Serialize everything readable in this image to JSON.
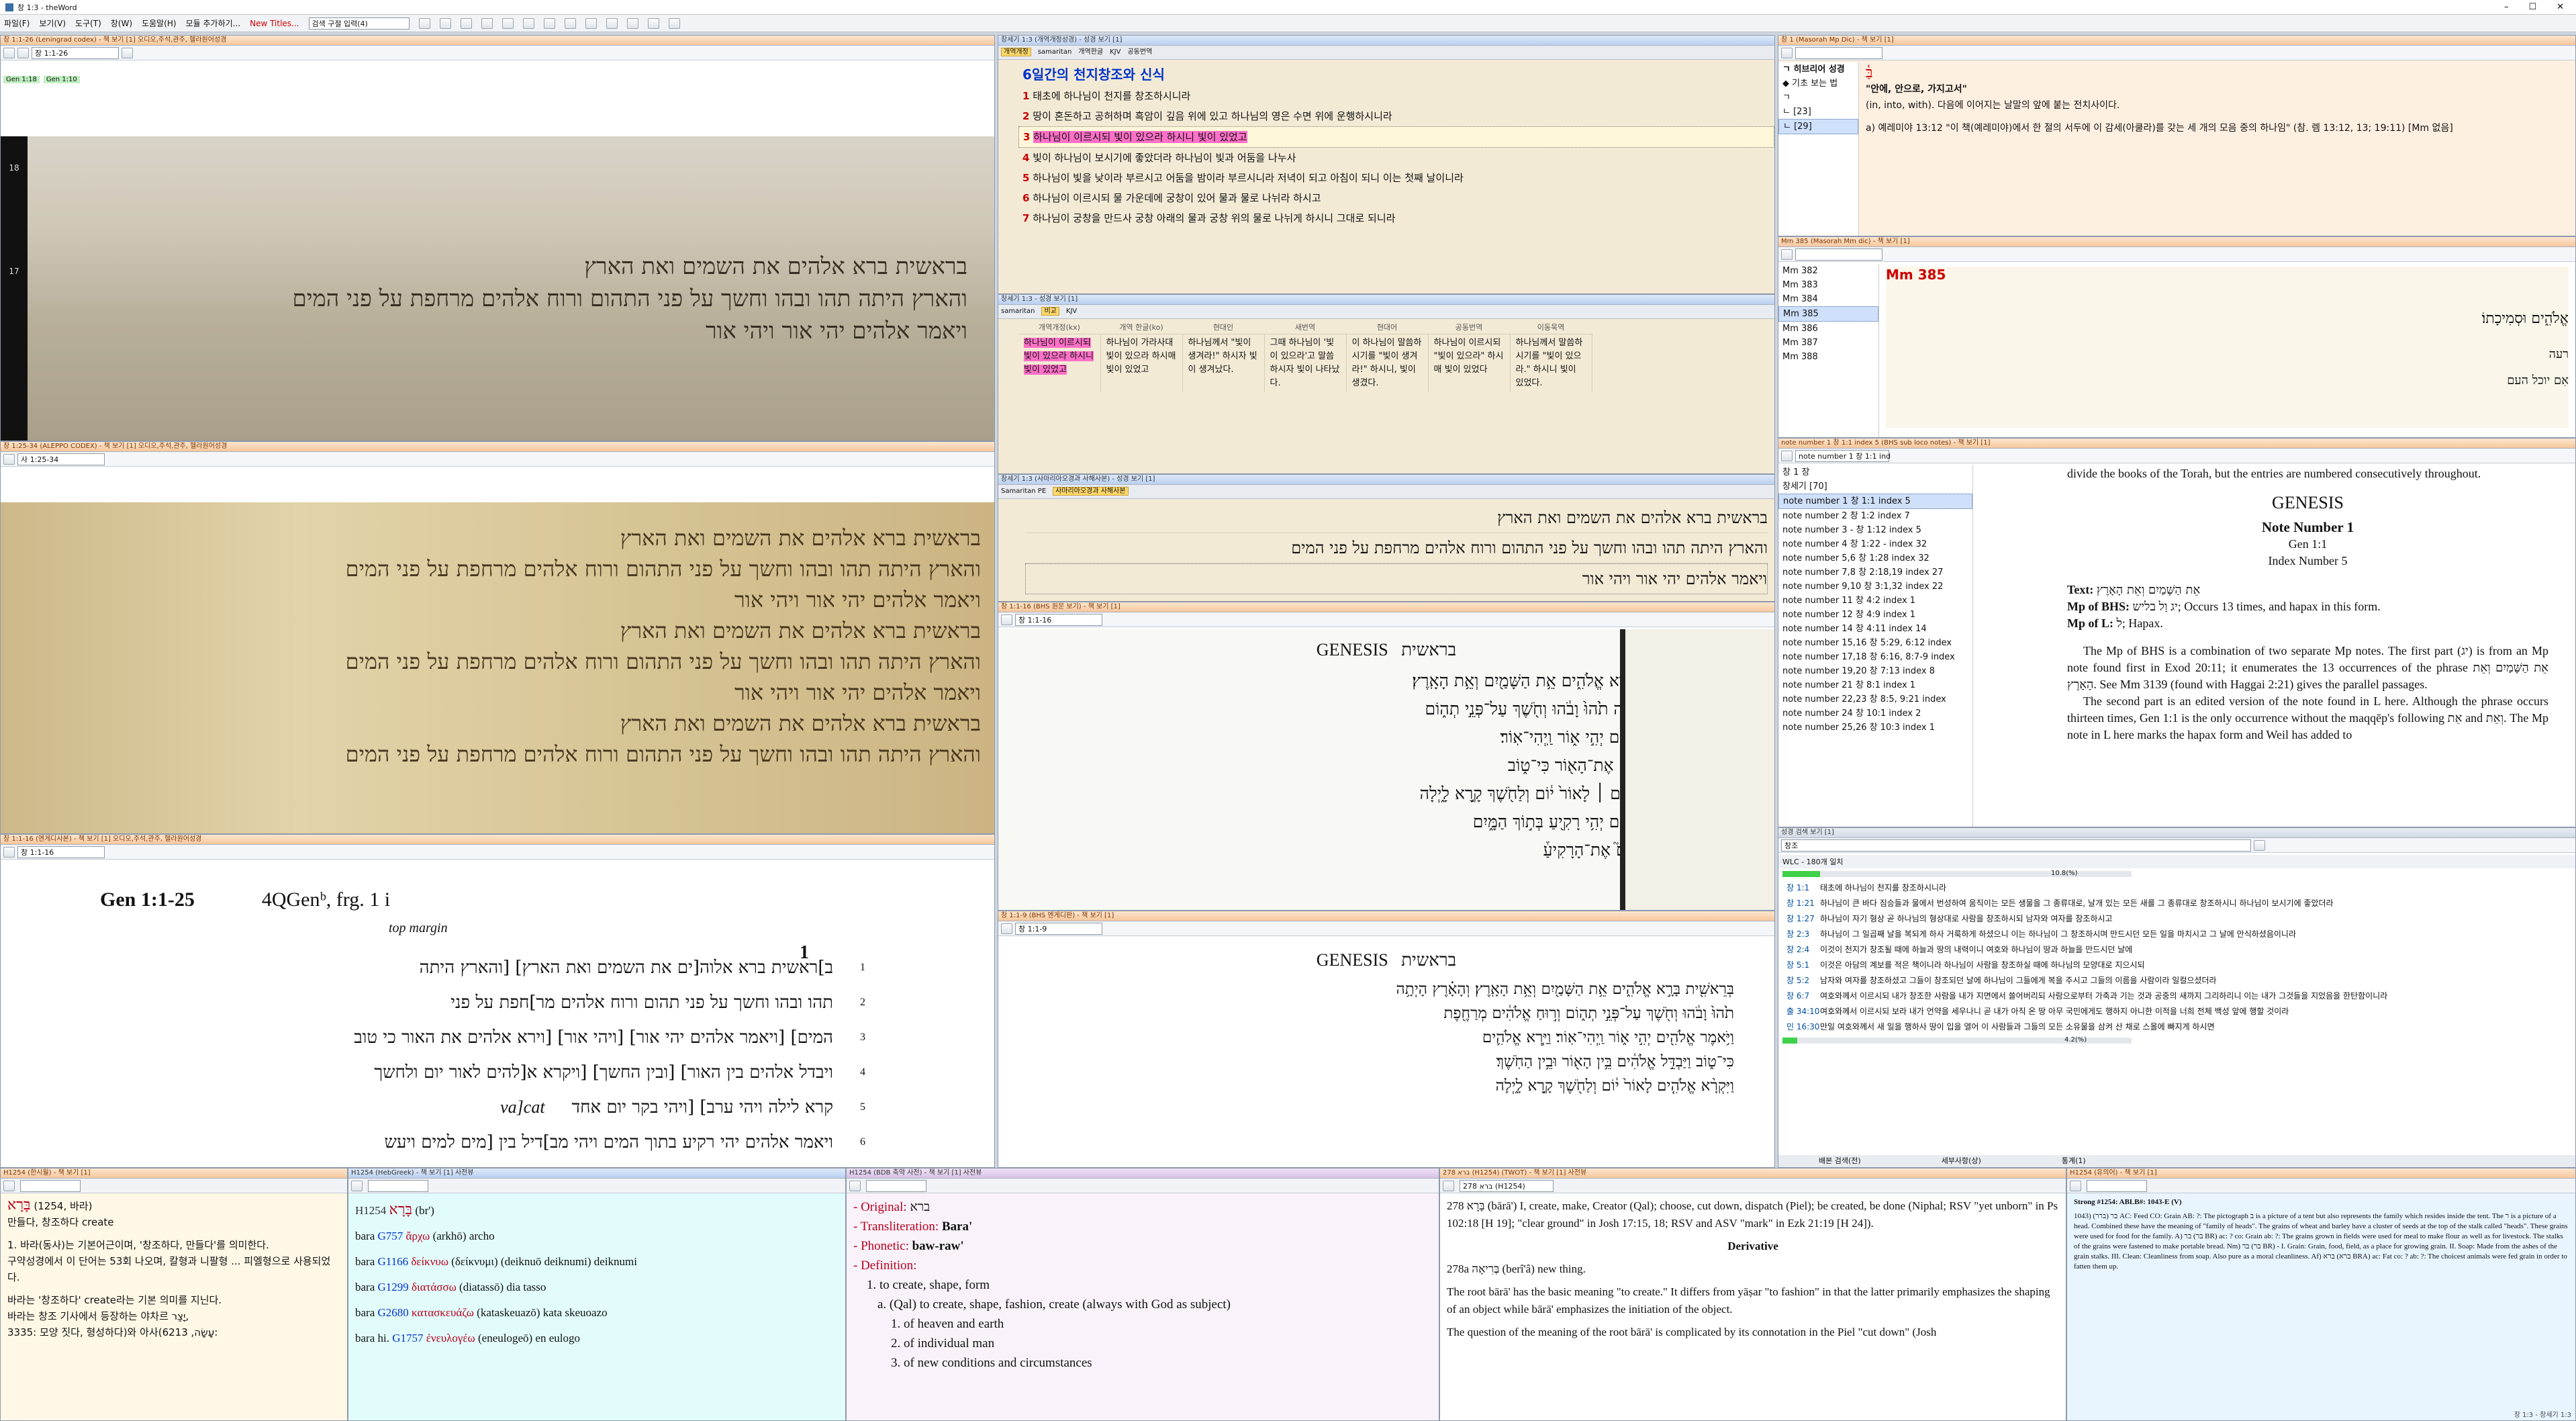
{
  "titlebar": {
    "title": "창 1:3 - theWord"
  },
  "menubar": [
    "파일(F)",
    "보기(V)",
    "도구(T)",
    "창(W)",
    "도움말(H)",
    "모듈 추가하기...",
    "New Titles...",
    "검색 구절 입력(4)"
  ],
  "panels": {
    "leningrad": {
      "title": "창 1:1-26 (Leningrad codex) - 책 보기 [1] 오디오,주석,관주, 헬라원어성경",
      "ref": "창 1:1-26",
      "badges": [
        "Gen 1:18",
        "Gen 1:10"
      ],
      "side": [
        "18",
        "17"
      ]
    },
    "aleppo": {
      "title": "창 1:25-34 (ALEPPO CODEX) - 책 보기 [1] 오디오,주석,관주, 헬라원어성경",
      "ref": "사 1:25-34"
    },
    "dss": {
      "title": "창 1:1-16 (엔게디사본) - 책 보기 [1] 오디오,주석,관주, 헬라원어성경",
      "ref": "창 1:1-16",
      "ref_title": "Gen 1:1-25",
      "frag": "4QGenᵇ, frg. 1 i",
      "margin": "top margin",
      "big_num": "1",
      "lines": [
        {
          "n": "1",
          "t": "ב]ראשית ברא אלוה[ים את השמים ואת הארץ] [והארץ היתה"
        },
        {
          "n": "2",
          "t": "תהו ובהו וחשך על פני תהום ורוח אלהים מר]חפת על פני"
        },
        {
          "n": "3",
          "t": "המים] [ויאמר אלהים יהי אור] [ויהי אור] [וירא אלהים את האור כי טוב"
        },
        {
          "n": "4",
          "t": "ויבדל אלהים בין האור] [ובין החשך] [ויקרא א[להים לאור יום ולחשך"
        },
        {
          "n": "5",
          "t": "קרא לילה ויהי ערב] [ויהי בקר יום אחד"
        },
        {
          "n": "6",
          "t": "ויאמר אלהים יהי רקיע בתוך המים ויהי מב]דיל בין [מים למים ויעש"
        }
      ],
      "vacat": "va]cat"
    },
    "korean": {
      "title": "창세기 1:3 (개역개정성경) - 성경 보기 [1]",
      "heading": "6일간의 천지창조와 신식",
      "verses": [
        {
          "n": "1",
          "t": "태초에 하나님이 천지를 창조하시니라"
        },
        {
          "n": "2",
          "t": "땅이 혼돈하고 공허하며 흑암이 깊음 위에 있고 하나님의 영은 수면 위에 운행하시니라"
        },
        {
          "n": "3",
          "t": "하나님이 이르시되 빛이 있으라 하시니 빛이 있었고"
        },
        {
          "n": "4",
          "t": "빛이 하나님이 보시기에 좋았더라 하나님이 빛과 어둠을 나누사"
        },
        {
          "n": "5",
          "t": "하나님이 빛을 낮이라 부르시고 어둠을 밤이라 부르시니라 저녁이 되고 아침이 되니 이는 첫째 날이니라"
        },
        {
          "n": "6",
          "t": "하나님이 이르시되 물 가운데에 궁창이 있어 물과 물로 나뉘라 하시고"
        },
        {
          "n": "7",
          "t": "하나님이 궁창을 만드사 궁창 아래의 물과 궁창 위의 물로 나뉘게 하시니 그대로 되니라"
        }
      ]
    },
    "compare": {
      "title": "창세기 1:3 - 성경 보기 [1]",
      "cols": [
        "개역개정(kx)",
        "개역 한글(ko)",
        "현대인",
        "새번역",
        "현대어",
        "공동번역",
        "이동욱역"
      ],
      "cells": [
        "하나님이 이르시되 빛이 있으라 하시니 빛이 있었고",
        "하나님이 가라사대 빛이 있으라 하시매 빛이 있었고",
        "하나님께서 \"빛이 생겨라!\" 하시자 빛이 생겨났다.",
        "그때 하나님이 '빛이 있으라'고 말씀하시자 빛이 나타났다.",
        "이 하나님이 말씀하시기를 \"빛이 생겨라!\" 하시니, 빛이 생겼다.",
        "하나님이 이르시되 \"빛이 있으라\" 하시매 빛이 있었다",
        "하나님께서 말씀하시기를 \"빛이 있으라.\" 하시니 빛이 있었다."
      ]
    },
    "bhs": {
      "title": "창세기 1:3 (사마리아오경과 사해사본) - 성경 보기 [1]",
      "lines": [
        "בראשית ברא אלהים את השמים ואת הארץ",
        "והארץ היתה תהו ובהו וחשך על פני התהום ורוח אלהים מרחפת על פני המים",
        "ויאמר אלהים יהי אור ויהי אור"
      ]
    },
    "bhs_print": {
      "title": "창 1:1-16 (BHS 원문 보기) - 책 보기 [1]",
      "ref": "창 1:1-16",
      "head_en": "GENESIS",
      "head_he": "בראשית",
      "lines": [
        "בְּרֵאשִׁ֖ית בָּרָ֣א אֱלֹהִ֑ים אֵ֥ת הַשָּׁמַ֖יִם וְאֵ֥ת הָאָֽרֶץ׃",
        "וְהָאָ֗רֶץ הָיְתָ֥ה תֹ֙הוּ֙ וָבֹ֔הוּ וְחֹ֖שֶׁךְ עַל־פְּנֵ֣י תְה֑וֹם",
        "וַיֹּ֥אמֶר אֱלֹהִ֖ים יְהִ֣י א֑וֹר וַֽיְהִי־אֽוֹר׃",
        "וַיַּ֧רְא אֱלֹהִ֛ים אֶת־הָא֖וֹר כִּי־ט֑וֹב",
        "וַיִּקְרָ֨א אֱלֹהִ֤ים ׀ לָאוֹר֙ י֔וֹם וְלַחֹ֖שֶׁךְ קָ֣רָא לָ֑יְלָה",
        "וַיֹּ֣אמֶר אֱלֹהִ֔ים יְהִ֥י רָקִ֖יעַ בְּת֣וֹךְ הַמָּ֑יִם",
        "וַיַּ֣עַשׂ אֱלֹהִים֮ אֶת־הָרָקִיעַ֒"
      ]
    },
    "bhs_print2": {
      "title": "창 1:1-9 (BHS 엔게디판) - 책 보기 [1]",
      "ref": "창 1:1-9",
      "head_en": "GENESIS",
      "head_he": "בראשית",
      "lines": [
        "בְּרֵאשִׁ֖ית בָּרָ֣א אֱלֹהִ֑ים אֵ֥ת הַשָּׁמַ֖יִם וְאֵ֥ת הָאָֽרֶץ׃ וְהָאָ֗רֶץ הָיְתָ֥ה",
        "תֹ֙הוּ֙ וָבֹ֔הוּ וְחֹ֖שֶׁךְ עַל־פְּנֵ֣י תְה֑וֹם וְר֣וּחַ אֱלֹהִ֔ים מְרַחֶ֖פֶת",
        "וַיֹּ֥אמֶר אֱלֹהִ֖ים יְהִ֣י א֑וֹר וַֽיְהִי־אֽוֹר׃ וַיַּ֧רְא אֱלֹהִ֛ים",
        "כִּי־ט֑וֹב וַיַּבְדֵּ֣ל אֱלֹהִ֔ים בֵּ֥ין הָא֖וֹר וּבֵ֥ין הַחֹֽשֶׁךְ׃",
        "וַיִּקְרָ֨א אֱלֹהִ֤ים לָאוֹר֙ י֔וֹם וְלַחֹ֖שֶׁךְ קָ֣רָא לָ֑יְלָה"
      ]
    },
    "masorah": {
      "title": "창 1 (Masorah Mp Dic) - 책 보기 [1]",
      "heading": "ㄱ 히브리어 성경",
      "bullet": "◆ 기초 보는 법",
      "items": [
        "ㄱ",
        "ㄴ [23]",
        "ㄴ [29]"
      ],
      "word": "בַּ֫",
      "def": "\"안에, 안으로, 가지고서\"",
      "sub": "(in, into, with). 다음에 이어지는 날말의 앞에 붙는 전치사이다.",
      "ex": "a) 예레미야 13:12 \"이 책(예레미야)에서 한 절의 서두에 이 감세(아쿨라)를 갖는 세 개의 모음 중의 하나임\" (참. 렘 13:12, 13; 19:11) [Mm 없음]"
    },
    "mm": {
      "title": "Mm 385 (Masorah Mm dic) - 책 보기 [1]",
      "items": [
        "Mm 382",
        "Mm 383",
        "Mm 384",
        "Mm 385",
        "Mm 386",
        "Mm 387",
        "Mm 388"
      ],
      "head": "Mm 385",
      "l1": "אֱלֹהִ֑ים וּסְמִיכָתוֹ׃",
      "l2": "רעה",
      "l3": "אִם יוכל העם"
    },
    "notes": {
      "title": "note number 1 창 1:1 index 5 (BHS sub loco notes) - 책 보기 [1]",
      "sel": "note number 1 창 1:1 ind",
      "items": [
        "창 1 장",
        "창세기 [70]",
        "note number 1 창 1:1 index 5",
        "note number 2 창 1:2 index 7",
        "note number 3 - 창 1:12 index 5",
        "note number 4 창 1:22 - index 32",
        "note number 5,6 창 1:28 index 32",
        "note number 7,8 창 2:18,19 index 27",
        "note number 9,10 창 3:1,32 index 22",
        "note number 11 창 4:2 index 1",
        "note number 12 창 4:9 index 1",
        "note number 14 창 4:11 index 14",
        "note number 15,16 창 5:29, 6:12 index",
        "note number 17,18 창 6:16, 8:7-9 index",
        "note number 19,20 창 7:13 index 8",
        "note number 21 창 8:1 index 1",
        "note number 22,23 창 8:5, 9:21 index",
        "note number 24 창 10:1 index 2",
        "note number 25,26 창 10:3 index 1"
      ],
      "top": "divide the books of the Torah, but the entries are numbered consecutively throughout.",
      "h1": "GENESIS",
      "h2": "Note Number 1",
      "h3": "Gen 1:1",
      "h4": "Index Number 5",
      "text_k": "Text:",
      "text_v": "אֵת הַשָּׁמַיִם וְאֵת הָאָרֶץ",
      "mpb_k": "Mp of BHS:",
      "mpb_v": "יג וַל בליש; Occurs 13 times, and hapax in this form.",
      "mpl_k": "Mp of L:",
      "mpl_v": "ל; Hapax.",
      "p1": "The Mp of BHS is a combination of two separate Mp notes. The first part (יג) is from an Mp note found first in Exod 20:11; it enumerates the 13 occurrences of the phrase אֵת הַשָּׁמַיִם וְאֵת הָאָרֶץ. See Mm 3139 (found with Haggai 2:21) gives the parallel passages.",
      "p2": "The second part is an edited version of the note found in L here. Although the phrase occurs thirteen times, Gen 1:1 is the only occurrence without the maqqēp's following אֵת and וְאֵת. The Mp note in L here marks the hapax form and Weil has added to"
    },
    "search": {
      "title": "성경 검색 보기 [1]",
      "query": "창조",
      "label": "WLC - 180개 일치",
      "pct1": "10.8(%)",
      "pct2": "4.2(%)",
      "progress1": 10.8,
      "progress2": 4.2,
      "rows": [
        {
          "r": "창 1:1",
          "t": "태초에 하나님이 천지를 창조하시니라"
        },
        {
          "r": "창 1:21",
          "t": "하나님이 큰 바다 짐승들과 물에서 번성하여 움직이는 모든 생물을 그 종류대로, 날개 있는 모든 새를 그 종류대로 창조하시니 하나님이 보시기에 좋았더라"
        },
        {
          "r": "창 1:27",
          "t": "하나님이 자기 형상 곧 하나님의 형상대로 사람을 창조하시되 남자와 여자를 창조하시고"
        },
        {
          "r": "창 2:3",
          "t": "하나님이 그 일곱째 날을 복되게 하사 거룩하게 하셨으니 이는 하나님이 그 창조하시며 만드시던 모든 일을 마치시고 그 날에 안식하셨음이니라"
        },
        {
          "r": "창 2:4",
          "t": "이것이 천지가 창조될 때에 하늘과 땅의 내력이니 여호와 하나님이 땅과 하늘을 만드시던 날에"
        },
        {
          "r": "창 5:1",
          "t": "이것은 아담의 계보를 적은 책이니라 하나님이 사람을 창조하실 때에 하나님의 모양대로 지으시되"
        },
        {
          "r": "창 5:2",
          "t": "남자와 여자를 창조하셨고 그들이 창조되던 날에 하나님이 그들에게 복을 주시고 그들의 이름을 사람이라 일컬으셨더라"
        },
        {
          "r": "창 6:7",
          "t": "여호와께서 이르시되 내가 창조한 사람을 내가 지면에서 쓸어버리되 사람으로부터 가축과 기는 것과 공중의 새까지 그리하리니 이는 내가 그것들을 지었음을 한탄함이니라"
        },
        {
          "r": "출 34:10",
          "t": "여호와께서 이르시되 보라 내가 언약을 세우나니 곧 내가 아직 온 땅 아무 국민에게도 행하지 아니한 이적을 너희 전체 백성 앞에 행할 것이라"
        },
        {
          "r": "민 16:30",
          "t": "만일 여호와께서 새 일을 행하사 땅이 입을 열어 이 사람들과 그들의 모든 소유물을 삼켜 산 채로 스올에 빠지게 하시면"
        }
      ],
      "footer": [
        "배본 검색(전)",
        "세부사항(상)",
        "통계(1)"
      ]
    },
    "lex1": {
      "title": "H1254 (한시월) - 책 보기 [1]",
      "hw": "בָּרָא",
      "hw_gl": "(1254, 바라)",
      "l1": "만들다, 창조하다 create",
      "l2": "1. 바라(동사)는 기본어근이며, '창조하다, 만들다'를 의미한다.",
      "l3": "구약성경에서 이 단어는 53회 나오며, 칼형과 니팔형 ... 피엘형으로 사용되었다.",
      "l4": "바라는 '창조하다' create라는 기본 의미를 지닌다.",
      "l5": "바라는 창조 기사에서 등장하는 야차르 יָצַר,",
      "l6": "3335: 모양 짓다, 형성하다)와 아사(עָשָׂה, 6213:"
    },
    "lex2": {
      "title": "H1254 (HebGreek) - 책 보기 [1] 사전뷰",
      "head": "H1254",
      "hw": "בָּרָא",
      "tr": "(br')",
      "rows": [
        {
          "a": "bara",
          "c": "G757",
          "g": "ἄρχω",
          "t": "(arkhō) archo"
        },
        {
          "a": "bara",
          "c": "G1166",
          "g": "δείκνυω",
          "t": "(δείκνυμι) (deiknuō deiknumi) deiknumi"
        },
        {
          "a": "bara",
          "c": "G1299",
          "g": "διατάσσω",
          "t": "(diatassō) dia tasso"
        },
        {
          "a": "bara",
          "c": "G2680",
          "g": "κατασκευάζω",
          "t": "(kataskeuazō) kata skeuoazo"
        },
        {
          "a": "bara hi.",
          "c": "G1757",
          "g": "ἐνευλογέω",
          "t": "(eneulogeō) en eulogo"
        }
      ]
    },
    "lex3": {
      "title": "H1254 (BDB 축약 사전) - 책 보기 [1] 사전뷰",
      "orig_k": "- Original:",
      "orig_v": "ברא",
      "tr_k": "- Transliteration:",
      "tr_v": "Bara'",
      "ph_k": "- Phonetic:",
      "ph_v": "baw-raw'",
      "def_k": "- Definition:",
      "d1": "1. to create, shape, form",
      "d2": "a. (Qal) to create, shape, fashion, create (always with God as subject)",
      "d3": "1. of heaven and earth",
      "d4": "2. of individual man",
      "d5": "3. of new conditions and circumstances"
    },
    "lex4": {
      "title": "278 ברא (H1254) (TWOT) - 책 보기 [1] 사전뷰",
      "ref": "278 ברא (H1254)",
      "p1": "278 בָּרָא (bārā') I, create, make, Creator (Qal); choose, cut down, dispatch (Piel); be created, be done (Niphal; RSV \"yet unborn\" in Ps 102:18 [H 19]; \"clear ground\" in Josh 17:15, 18; RSV and ASV \"mark\" in Ezk 21:19 [H 24]).",
      "derivative": "Derivative",
      "p2": "278a בְּרִיאָה (berî'â) new thing.",
      "p3": "The root bārā' has the basic meaning \"to create.\" It differs from yāṣar \"to fashion\" in that the latter primarily emphasizes the shaping of an object while bārā' emphasizes the initiation of the object.",
      "p4": "The question of the meaning of the root bārā' is complicated by its connotation in the Piel \"cut down\" (Josh"
    },
    "lex5": {
      "title": "H1254 (유의어) - 책 보기 [1]",
      "head": "Strong #1254: ABLB#: 1043-E (V)",
      "body": "1043) בר (ברר) AC: Feed CO: Grain AB: ?: The pictograph ב is a picture of a tent but also represents the family which resides inside the tent. The ר is a picture of a head. Combined these have the meaning of \"family of heads\". The grains of wheat and barley have a cluster of seeds at the top of the stalk called \"heads\". These grains were used for food for the family. A) בר (בר BR) ac: ? co: Grain ab: ?: The grains grown in fields were used for meal to make flour as well as for livestock. The stalks of the grains were fastened to make portable bread. Nm) בר (בר BR) - I. Grain: Grain, food, field, as a place for growing grain. II. Soap: Made from the ashes of the grain stalks. III. Clean: Cleanliness from soap. Also pure as a moral cleanliness. Af) ברא (ברא BRA) ac: Fat co: ? ab: ?: The choicest animals were fed grain in order to fatten them up."
    }
  },
  "status": "창 1:3 - 창세기 1:3"
}
